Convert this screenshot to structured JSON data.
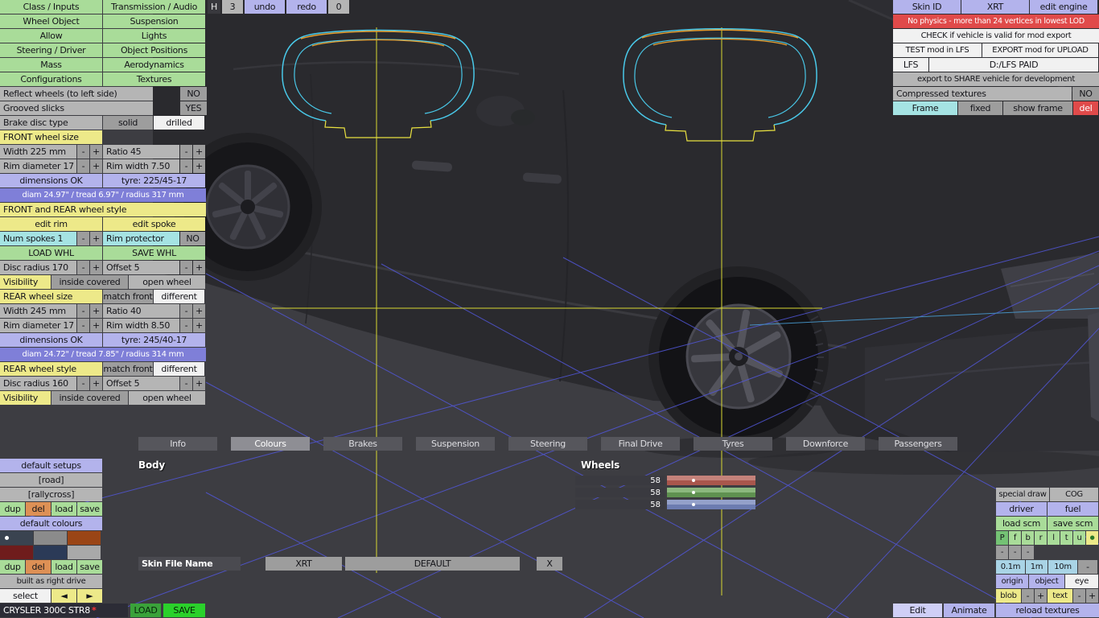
{
  "toolbar": {
    "history": "H",
    "count": "3",
    "undo": "undo",
    "redo": "redo",
    "zero": "0"
  },
  "glyphs": {
    "minus": "-",
    "plus": "+"
  },
  "left_panel": {
    "nav": [
      "Class / Inputs",
      "Transmission / Audio",
      "Wheel Object",
      "Suspension",
      "Allow",
      "Lights",
      "Steering / Driver",
      "Object Positions",
      "Mass",
      "Aerodynamics",
      "Configurations",
      "Textures"
    ],
    "reflect_label": "Reflect wheels (to left side)",
    "reflect_value": "NO",
    "grooved_label": "Grooved slicks",
    "grooved_value": "YES",
    "brake_label": "Brake disc type",
    "brake_solid": "solid",
    "brake_drilled": "drilled",
    "front_header": "FRONT wheel size",
    "front_width": "Width 225 mm",
    "front_ratio": "Ratio 45",
    "front_rim_diameter": "Rim diameter 17",
    "front_rim_width": "Rim width 7.50",
    "front_dimensions": "dimensions OK",
    "front_tyre": "tyre: 225/45-17",
    "front_info": "diam 24.97\" / tread 6.97\" / radius 317 mm",
    "style_header": "FRONT and REAR wheel style",
    "edit_rim": "edit rim",
    "edit_spoke": "edit spoke",
    "num_spokes": "Num spokes 1",
    "rim_protector": "Rim protector",
    "rim_protector_value": "NO",
    "load_whl": "LOAD WHL",
    "save_whl": "SAVE WHL",
    "front_disc_radius": "Disc radius 170",
    "front_offset": "Offset 5",
    "visibility": "Visibility",
    "inside_covered": "inside covered",
    "open_wheel": "open wheel",
    "rear_header": "REAR wheel size",
    "match_front": "match front",
    "different": "different",
    "rear_width": "Width 245 mm",
    "rear_ratio": "Ratio 40",
    "rear_rim_diameter": "Rim diameter 17",
    "rear_rim_width": "Rim width 8.50",
    "rear_dimensions": "dimensions OK",
    "rear_tyre": "tyre: 245/40-17",
    "rear_info": "diam 24.72\" / tread 7.85\" / radius 314 mm",
    "rear_style_header": "REAR wheel style",
    "rear_disc_radius": "Disc radius 160",
    "rear_offset": "Offset 5"
  },
  "top_right": {
    "skin_id": "Skin ID",
    "skin_value": "XRT",
    "edit_engine": "edit engine",
    "warning": "No physics - more than 24 vertices in lowest LOD",
    "check": "CHECK if vehicle is valid for mod export",
    "test": "TEST mod in LFS",
    "export": "EXPORT mod for UPLOAD",
    "lfs": "LFS",
    "lfs_path": "D:/LFS PAID",
    "share": "export to SHARE vehicle for development",
    "compressed_label": "Compressed textures",
    "compressed_value": "NO",
    "frame": "Frame",
    "fixed": "fixed",
    "show_frame": "show frame",
    "del": "del"
  },
  "tabs": {
    "items": [
      "Info",
      "Colours",
      "Brakes",
      "Suspension",
      "Steering",
      "Final Drive",
      "Tyres",
      "Downforce",
      "Passengers"
    ],
    "selected": "Colours"
  },
  "colours_page": {
    "body_label": "Body",
    "wheels_label": "Wheels",
    "wheel_rgb": [
      {
        "channel": "red",
        "value": "58"
      },
      {
        "channel": "green",
        "value": "58"
      },
      {
        "channel": "blue",
        "value": "58"
      }
    ]
  },
  "skin_row": {
    "label": "Skin File Name",
    "skin": "XRT",
    "name": "DEFAULT",
    "clear": "X"
  },
  "setups_panel": {
    "default_setups": "default setups",
    "setups": [
      "[road]",
      "[rallycross]"
    ],
    "dup": "dup",
    "del": "del",
    "load": "load",
    "save": "save",
    "default_colours": "default colours",
    "built": "built as right drive",
    "select": "select",
    "prev": "◄",
    "next": "►"
  },
  "bottom_right": {
    "special_draw": "special draw",
    "cog": "COG",
    "driver": "driver",
    "fuel": "fuel",
    "load_scm": "load scm",
    "save_scm": "save scm",
    "views": [
      "P",
      "f",
      "b",
      "r",
      "l",
      "t",
      "u"
    ],
    "view_dot": "●",
    "grid_small": "0.1m",
    "grid_med": "1m",
    "grid_large": "10m",
    "origin": "origin",
    "object": "object",
    "eye": "eye",
    "blob": "blob",
    "text": "text"
  },
  "footer": {
    "car_name": "CRYSLER 300C STR8",
    "modified": "*",
    "load": "LOAD",
    "save": "SAVE",
    "edit": "Edit",
    "animate": "Animate",
    "reload_textures": "reload textures"
  },
  "colors": {
    "button_green": "#a9dc99",
    "button_yellow": "#ede989",
    "button_lavender": "#b3b3ec",
    "button_cyan": "#a5e3e3",
    "warning_red": "#e04a4a",
    "info_blue": "#7f7fd8",
    "save_green": "#2bd12b",
    "grid_blue": "#5156d8",
    "guide_yellow": "#d8d833",
    "wireframe_cyan": "#49c8e8",
    "wireframe_orange": "#e8a030",
    "slider_red": "#a9564c",
    "slider_green": "#5f9150",
    "slider_blue": "#6c7cb0"
  }
}
